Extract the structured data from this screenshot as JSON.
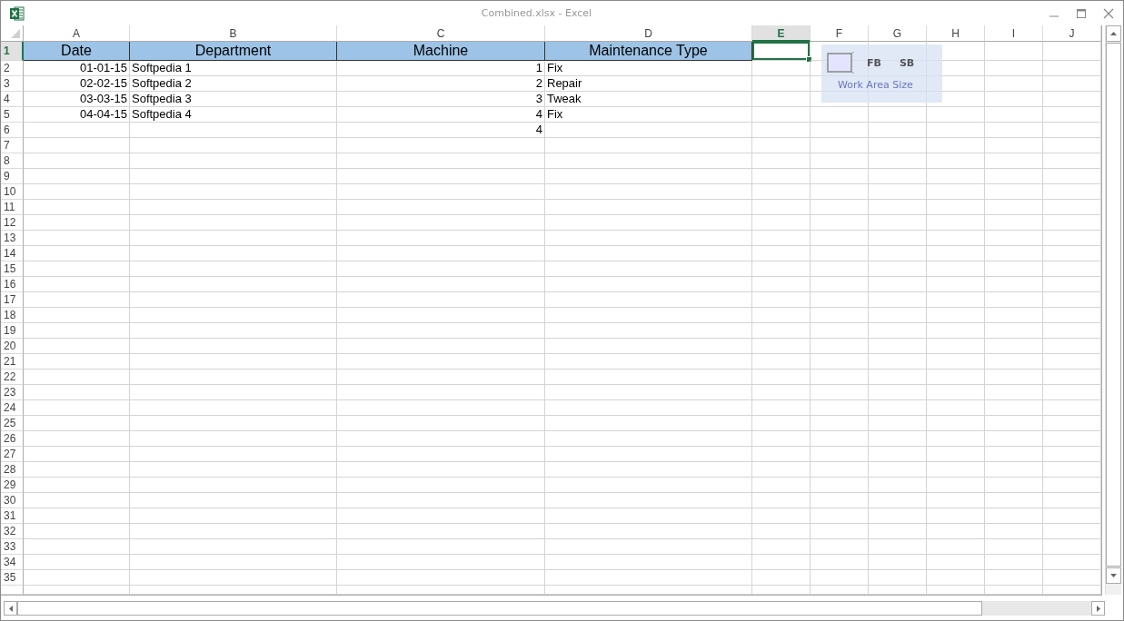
{
  "window": {
    "title": "Combined.xlsx - Excel"
  },
  "columns": [
    {
      "label": "A",
      "selected": false
    },
    {
      "label": "B",
      "selected": false
    },
    {
      "label": "C",
      "selected": false
    },
    {
      "label": "D",
      "selected": false
    },
    {
      "label": "E",
      "selected": true
    },
    {
      "label": "F",
      "selected": false
    },
    {
      "label": "G",
      "selected": false
    },
    {
      "label": "H",
      "selected": false
    },
    {
      "label": "I",
      "selected": false
    },
    {
      "label": "J",
      "selected": false
    }
  ],
  "rows": [
    {
      "number": "1",
      "selected": true,
      "kind": "header",
      "cells": [
        {
          "text": "Date",
          "kind": "text"
        },
        {
          "text": "Department",
          "kind": "text"
        },
        {
          "text": "Machine",
          "kind": "text"
        },
        {
          "text": "Maintenance Type",
          "kind": "text"
        }
      ]
    },
    {
      "number": "2",
      "selected": false,
      "kind": "data",
      "cells": [
        {
          "text": "01-01-15",
          "kind": "number"
        },
        {
          "text": "Softpedia 1",
          "kind": "text"
        },
        {
          "text": "1",
          "kind": "number"
        },
        {
          "text": "Fix",
          "kind": "text"
        }
      ]
    },
    {
      "number": "3",
      "selected": false,
      "kind": "data",
      "cells": [
        {
          "text": "02-02-15",
          "kind": "number"
        },
        {
          "text": "Softpedia 2",
          "kind": "text"
        },
        {
          "text": "2",
          "kind": "number"
        },
        {
          "text": "Repair",
          "kind": "text"
        }
      ]
    },
    {
      "number": "4",
      "selected": false,
      "kind": "data",
      "cells": [
        {
          "text": "03-03-15",
          "kind": "number"
        },
        {
          "text": "Softpedia 3",
          "kind": "text"
        },
        {
          "text": "3",
          "kind": "number"
        },
        {
          "text": "Tweak",
          "kind": "text"
        }
      ]
    },
    {
      "number": "5",
      "selected": false,
      "kind": "data",
      "cells": [
        {
          "text": "04-04-15",
          "kind": "number"
        },
        {
          "text": "Softpedia 4",
          "kind": "text"
        },
        {
          "text": "4",
          "kind": "number"
        },
        {
          "text": "Fix",
          "kind": "text"
        }
      ]
    },
    {
      "number": "6",
      "selected": false,
      "kind": "data",
      "cells": [
        null,
        null,
        {
          "text": "4",
          "kind": "number"
        },
        null
      ]
    },
    {
      "number": "7",
      "selected": false,
      "kind": "data",
      "cells": []
    },
    {
      "number": "8",
      "selected": false,
      "kind": "data",
      "cells": []
    },
    {
      "number": "9",
      "selected": false,
      "kind": "data",
      "cells": []
    },
    {
      "number": "10",
      "selected": false,
      "kind": "data",
      "cells": []
    },
    {
      "number": "11",
      "selected": false,
      "kind": "data",
      "cells": []
    },
    {
      "number": "12",
      "selected": false,
      "kind": "data",
      "cells": []
    },
    {
      "number": "13",
      "selected": false,
      "kind": "data",
      "cells": []
    },
    {
      "number": "14",
      "selected": false,
      "kind": "data",
      "cells": []
    },
    {
      "number": "15",
      "selected": false,
      "kind": "data",
      "cells": []
    },
    {
      "number": "16",
      "selected": false,
      "kind": "data",
      "cells": []
    },
    {
      "number": "17",
      "selected": false,
      "kind": "data",
      "cells": []
    },
    {
      "number": "18",
      "selected": false,
      "kind": "data",
      "cells": []
    },
    {
      "number": "19",
      "selected": false,
      "kind": "data",
      "cells": []
    },
    {
      "number": "20",
      "selected": false,
      "kind": "data",
      "cells": []
    },
    {
      "number": "21",
      "selected": false,
      "kind": "data",
      "cells": []
    },
    {
      "number": "22",
      "selected": false,
      "kind": "data",
      "cells": []
    },
    {
      "number": "23",
      "selected": false,
      "kind": "data",
      "cells": []
    },
    {
      "number": "24",
      "selected": false,
      "kind": "data",
      "cells": []
    },
    {
      "number": "25",
      "selected": false,
      "kind": "data",
      "cells": []
    },
    {
      "number": "26",
      "selected": false,
      "kind": "data",
      "cells": []
    },
    {
      "number": "27",
      "selected": false,
      "kind": "data",
      "cells": []
    },
    {
      "number": "28",
      "selected": false,
      "kind": "data",
      "cells": []
    },
    {
      "number": "29",
      "selected": false,
      "kind": "data",
      "cells": []
    },
    {
      "number": "30",
      "selected": false,
      "kind": "data",
      "cells": []
    },
    {
      "number": "31",
      "selected": false,
      "kind": "data",
      "cells": []
    },
    {
      "number": "32",
      "selected": false,
      "kind": "data",
      "cells": []
    },
    {
      "number": "33",
      "selected": false,
      "kind": "data",
      "cells": []
    },
    {
      "number": "34",
      "selected": false,
      "kind": "data",
      "cells": []
    },
    {
      "number": "35",
      "selected": false,
      "kind": "data",
      "cells": []
    }
  ],
  "work_area_widget": {
    "buttons": [
      "FB",
      "SB"
    ],
    "label": "Work Area Size"
  }
}
